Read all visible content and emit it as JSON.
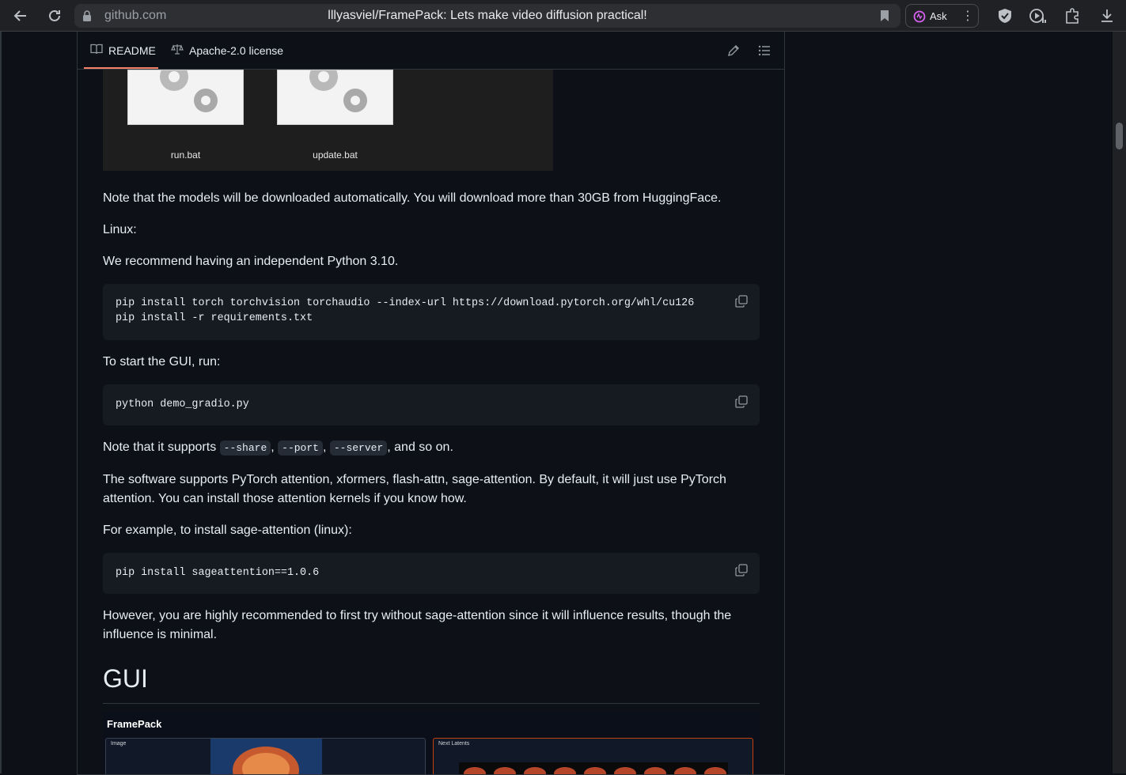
{
  "browser": {
    "host": "github.com",
    "tab_title": "lllyasviel/FramePack: Lets make video diffusion practical!",
    "ask_label": "Ask",
    "toolbar_icons": [
      "back-icon",
      "reload-icon",
      "shield-icon",
      "media-icon",
      "puzzle-icon",
      "download-icon"
    ]
  },
  "readme_header": {
    "readme_tab": "README",
    "license_tab": "Apache-2.0 license"
  },
  "bat_files": {
    "run_label": "run.bat",
    "update_label": "update.bat"
  },
  "content": {
    "note_models": "Note that the models will be downloaded automatically. You will download more than 30GB from HuggingFace.",
    "linux_label": "Linux:",
    "recommend_python": "We recommend having an independent Python 3.10.",
    "code_install_line1": "pip install torch torchvision torchaudio --index-url https://download.pytorch.org/whl/cu126",
    "code_install_line2": "pip install -r requirements.txt",
    "start_gui": "To start the GUI, run:",
    "code_run": "python demo_gradio.py",
    "supports_prefix": "Note that it supports ",
    "flag_share": "--share",
    "flag_port": "--port",
    "flag_server": "--server",
    "supports_suffix": ", and so on.",
    "attention_line1": "The software supports PyTorch attention, xformers, flash-attn, sage-attention. By default, it will just use PyTorch",
    "attention_line2": "attention. You can install those attention kernels if you know how.",
    "example_sage": "For example, to install sage-attention (linux):",
    "code_sage": "pip install sageattention==1.0.6",
    "recommend_line1": "However, you are highly recommended to first try without sage-attention since it will influence results, though the",
    "recommend_line2": "influence is minimal.",
    "gui_heading": "GUI"
  },
  "gui_screenshot": {
    "app_title": "FramePack",
    "left_panel_label": "Image",
    "right_panel_label": "Next Latents"
  },
  "colors": {
    "page_bg": "#0d1117",
    "code_bg": "#161b22",
    "tab_accent": "#f78166",
    "border": "#30363d"
  }
}
